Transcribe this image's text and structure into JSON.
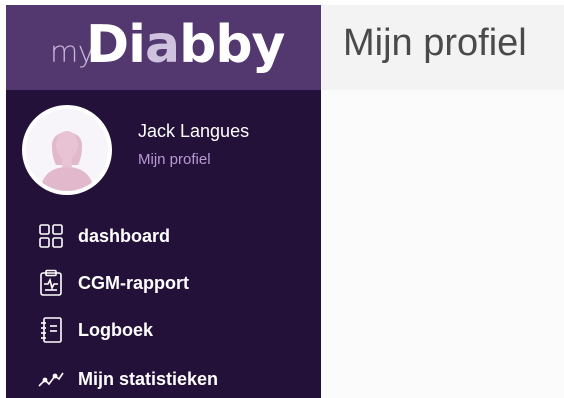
{
  "logo": {
    "prefix": "my",
    "word_start": "Di",
    "word_highlight": "a",
    "word_end": "bby"
  },
  "user": {
    "name": "Jack Langues",
    "profile_link": "Mijn profiel"
  },
  "nav": {
    "items": [
      {
        "label": "dashboard",
        "icon": "dashboard-grid-icon"
      },
      {
        "label": "CGM-rapport",
        "icon": "clipboard-chart-icon"
      },
      {
        "label": "Logboek",
        "icon": "notebook-icon"
      },
      {
        "label": "Mijn statistieken",
        "icon": "trend-line-icon"
      }
    ]
  },
  "main": {
    "title": "Mijn profiel"
  },
  "colors": {
    "sidebar_bg": "#241139",
    "logo_bar_bg": "#52386f",
    "accent_link": "#b89ad6",
    "header_bg": "#f3f3f3"
  }
}
